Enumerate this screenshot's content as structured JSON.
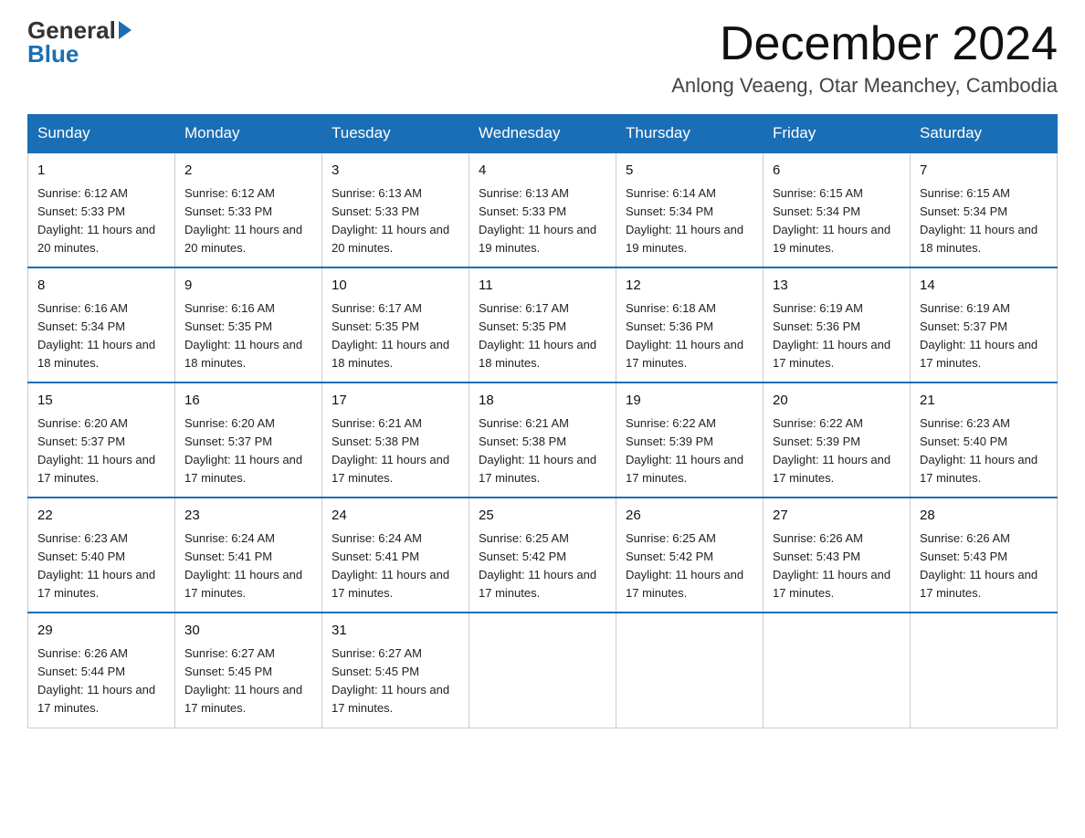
{
  "header": {
    "logo_general": "General",
    "logo_blue": "Blue",
    "month_title": "December 2024",
    "location": "Anlong Veaeng, Otar Meanchey, Cambodia"
  },
  "days_of_week": [
    "Sunday",
    "Monday",
    "Tuesday",
    "Wednesday",
    "Thursday",
    "Friday",
    "Saturday"
  ],
  "weeks": [
    [
      {
        "day": "1",
        "sunrise": "6:12 AM",
        "sunset": "5:33 PM",
        "daylight": "11 hours and 20 minutes."
      },
      {
        "day": "2",
        "sunrise": "6:12 AM",
        "sunset": "5:33 PM",
        "daylight": "11 hours and 20 minutes."
      },
      {
        "day": "3",
        "sunrise": "6:13 AM",
        "sunset": "5:33 PM",
        "daylight": "11 hours and 20 minutes."
      },
      {
        "day": "4",
        "sunrise": "6:13 AM",
        "sunset": "5:33 PM",
        "daylight": "11 hours and 19 minutes."
      },
      {
        "day": "5",
        "sunrise": "6:14 AM",
        "sunset": "5:34 PM",
        "daylight": "11 hours and 19 minutes."
      },
      {
        "day": "6",
        "sunrise": "6:15 AM",
        "sunset": "5:34 PM",
        "daylight": "11 hours and 19 minutes."
      },
      {
        "day": "7",
        "sunrise": "6:15 AM",
        "sunset": "5:34 PM",
        "daylight": "11 hours and 18 minutes."
      }
    ],
    [
      {
        "day": "8",
        "sunrise": "6:16 AM",
        "sunset": "5:34 PM",
        "daylight": "11 hours and 18 minutes."
      },
      {
        "day": "9",
        "sunrise": "6:16 AM",
        "sunset": "5:35 PM",
        "daylight": "11 hours and 18 minutes."
      },
      {
        "day": "10",
        "sunrise": "6:17 AM",
        "sunset": "5:35 PM",
        "daylight": "11 hours and 18 minutes."
      },
      {
        "day": "11",
        "sunrise": "6:17 AM",
        "sunset": "5:35 PM",
        "daylight": "11 hours and 18 minutes."
      },
      {
        "day": "12",
        "sunrise": "6:18 AM",
        "sunset": "5:36 PM",
        "daylight": "11 hours and 17 minutes."
      },
      {
        "day": "13",
        "sunrise": "6:19 AM",
        "sunset": "5:36 PM",
        "daylight": "11 hours and 17 minutes."
      },
      {
        "day": "14",
        "sunrise": "6:19 AM",
        "sunset": "5:37 PM",
        "daylight": "11 hours and 17 minutes."
      }
    ],
    [
      {
        "day": "15",
        "sunrise": "6:20 AM",
        "sunset": "5:37 PM",
        "daylight": "11 hours and 17 minutes."
      },
      {
        "day": "16",
        "sunrise": "6:20 AM",
        "sunset": "5:37 PM",
        "daylight": "11 hours and 17 minutes."
      },
      {
        "day": "17",
        "sunrise": "6:21 AM",
        "sunset": "5:38 PM",
        "daylight": "11 hours and 17 minutes."
      },
      {
        "day": "18",
        "sunrise": "6:21 AM",
        "sunset": "5:38 PM",
        "daylight": "11 hours and 17 minutes."
      },
      {
        "day": "19",
        "sunrise": "6:22 AM",
        "sunset": "5:39 PM",
        "daylight": "11 hours and 17 minutes."
      },
      {
        "day": "20",
        "sunrise": "6:22 AM",
        "sunset": "5:39 PM",
        "daylight": "11 hours and 17 minutes."
      },
      {
        "day": "21",
        "sunrise": "6:23 AM",
        "sunset": "5:40 PM",
        "daylight": "11 hours and 17 minutes."
      }
    ],
    [
      {
        "day": "22",
        "sunrise": "6:23 AM",
        "sunset": "5:40 PM",
        "daylight": "11 hours and 17 minutes."
      },
      {
        "day": "23",
        "sunrise": "6:24 AM",
        "sunset": "5:41 PM",
        "daylight": "11 hours and 17 minutes."
      },
      {
        "day": "24",
        "sunrise": "6:24 AM",
        "sunset": "5:41 PM",
        "daylight": "11 hours and 17 minutes."
      },
      {
        "day": "25",
        "sunrise": "6:25 AM",
        "sunset": "5:42 PM",
        "daylight": "11 hours and 17 minutes."
      },
      {
        "day": "26",
        "sunrise": "6:25 AM",
        "sunset": "5:42 PM",
        "daylight": "11 hours and 17 minutes."
      },
      {
        "day": "27",
        "sunrise": "6:26 AM",
        "sunset": "5:43 PM",
        "daylight": "11 hours and 17 minutes."
      },
      {
        "day": "28",
        "sunrise": "6:26 AM",
        "sunset": "5:43 PM",
        "daylight": "11 hours and 17 minutes."
      }
    ],
    [
      {
        "day": "29",
        "sunrise": "6:26 AM",
        "sunset": "5:44 PM",
        "daylight": "11 hours and 17 minutes."
      },
      {
        "day": "30",
        "sunrise": "6:27 AM",
        "sunset": "5:45 PM",
        "daylight": "11 hours and 17 minutes."
      },
      {
        "day": "31",
        "sunrise": "6:27 AM",
        "sunset": "5:45 PM",
        "daylight": "11 hours and 17 minutes."
      },
      null,
      null,
      null,
      null
    ]
  ],
  "labels": {
    "sunrise_prefix": "Sunrise: ",
    "sunset_prefix": "Sunset: ",
    "daylight_prefix": "Daylight: "
  }
}
